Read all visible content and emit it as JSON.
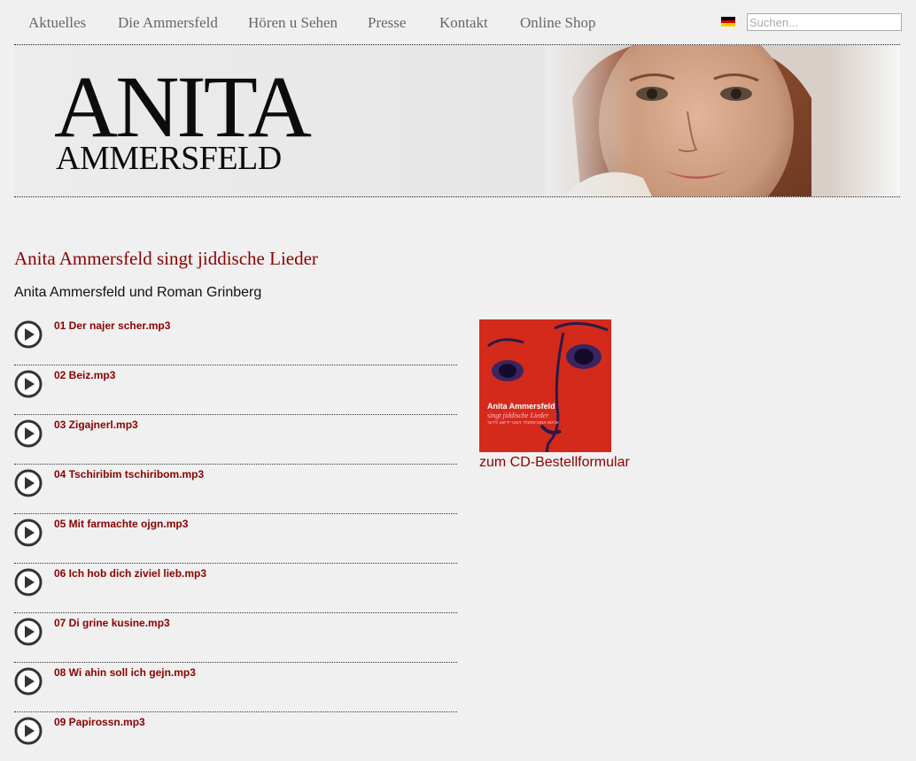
{
  "nav": {
    "items": [
      {
        "label": "Aktuelles"
      },
      {
        "label": "Die Ammersfeld"
      },
      {
        "label": "Hören u Sehen"
      },
      {
        "label": "Presse"
      },
      {
        "label": "Kontakt"
      },
      {
        "label": "Online Shop"
      }
    ],
    "language_icon": "german-flag-icon",
    "search_placeholder": "Suchen..."
  },
  "banner": {
    "logo_line1": "ANITA",
    "logo_line2": "AMMERSFELD"
  },
  "main": {
    "title": "Anita Ammersfeld singt jiddische Lieder",
    "subtitle": "Anita Ammersfeld und Roman Grinberg",
    "play_icon": "play-circle-icon",
    "tracks": [
      {
        "title": "01 Der najer scher.mp3"
      },
      {
        "title": "02 Beiz.mp3"
      },
      {
        "title": "03 Zigajnerl.mp3"
      },
      {
        "title": "04 Tschiribim tschiribom.mp3"
      },
      {
        "title": "05 Mit farmachte ojgn.mp3"
      },
      {
        "title": "06 Ich hob dich ziviel lieb.mp3"
      },
      {
        "title": "07 Di grine kusine.mp3"
      },
      {
        "title": "08 Wi ahin soll ich gejn.mp3"
      },
      {
        "title": "09 Papirossn.mp3"
      }
    ]
  },
  "cd": {
    "cover_artist": "Anita Ammersfeld",
    "cover_title": "singt jiddische Lieder",
    "cover_hebrew": "אניטא אמערספעלד זינגט יידישע לידער",
    "order_link": "zum CD-Bestellformular"
  },
  "colors": {
    "accent": "#8b0000",
    "background": "#f0f0f0",
    "cd_red": "#d42a1b"
  }
}
